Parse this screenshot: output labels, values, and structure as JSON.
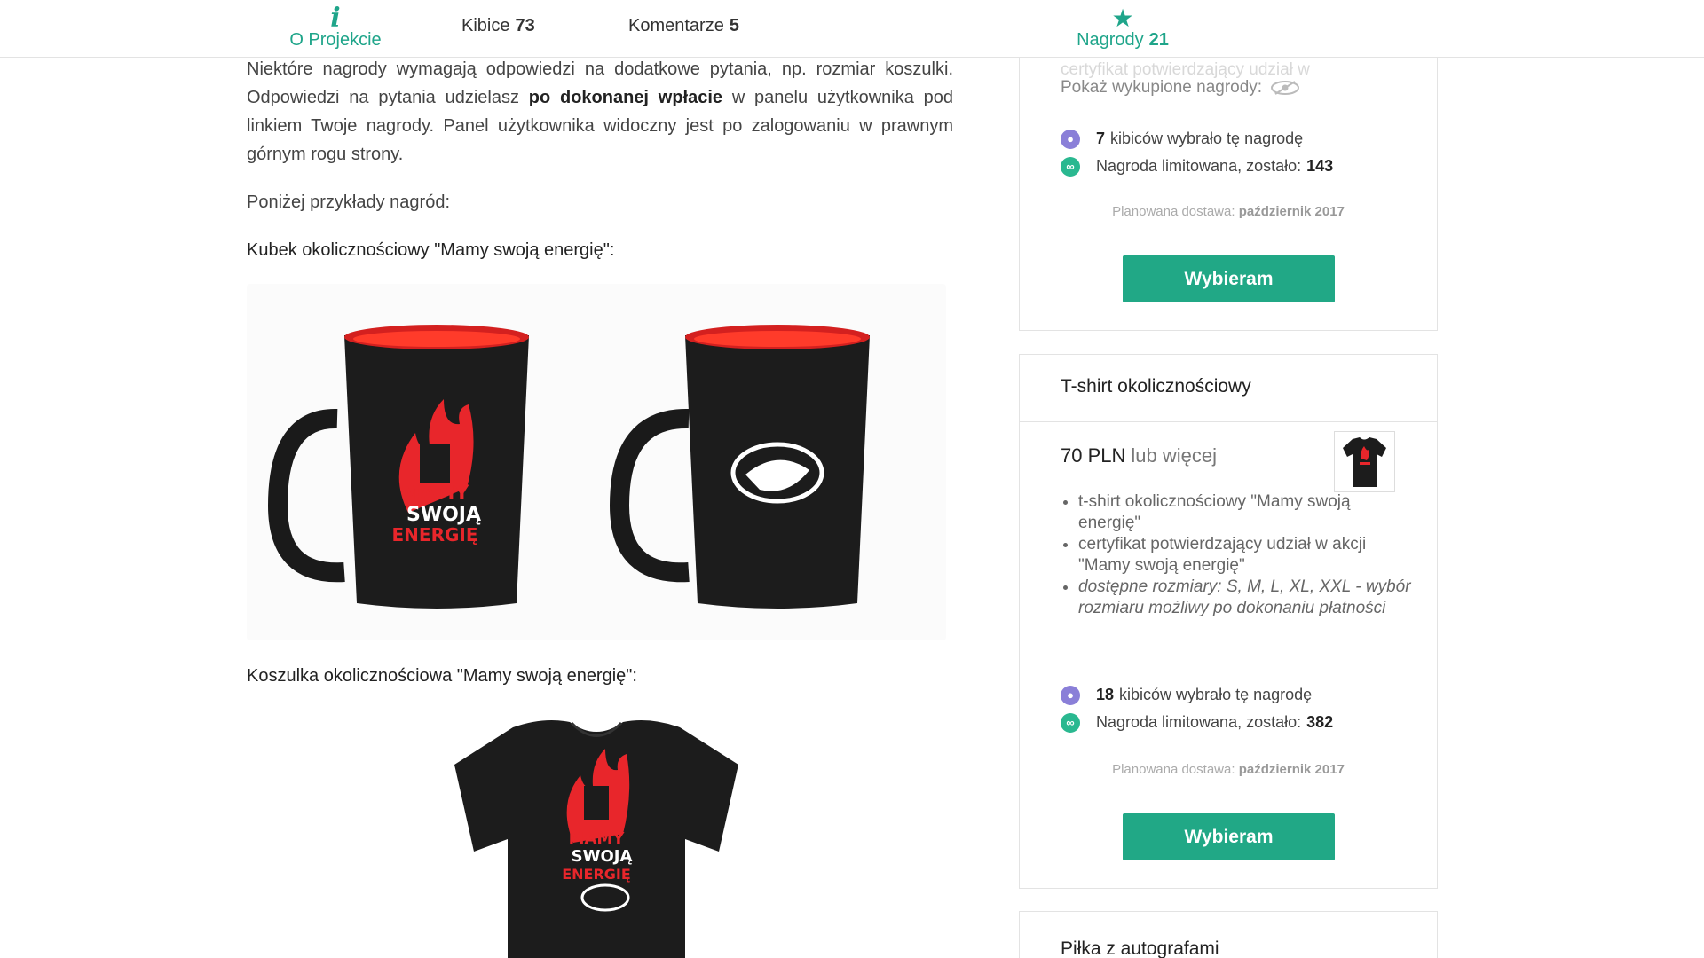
{
  "nav": {
    "about": {
      "label": "O Projekcie"
    },
    "fans": {
      "label": "Kibice",
      "count": "73"
    },
    "comments": {
      "label": "Komentarze",
      "count": "5"
    },
    "rewards": {
      "label": "Nagrody",
      "count": "21"
    }
  },
  "article": {
    "para1_a": "Niektóre nagrody wymagają odpowiedzi na dodatkowe pytania, np. rozmiar koszulki. Odpowiedzi na pytania udzielasz ",
    "para1_strong": "po dokonanej wpłacie",
    "para1_b": " w panelu użytkownika pod linkiem Twoje nagrody. Panel użytkownika widoczny jest po zalogowaniu w prawnym górnym rogu strony.",
    "para2": "Poniżej przykłady nagród:",
    "heading_mug": "Kubek okolicznościowy \"Mamy swoją energię\":",
    "heading_shirt": "Koszulka okolicznościowa \"Mamy swoją energię\":",
    "logo_line1": "MAMY",
    "logo_line2": "SWOJĄ",
    "logo_line3": "ENERGIĘ"
  },
  "reward1": {
    "ghost_item": "certyfikat potwierdzający udział w",
    "show_redeemed": "Pokaż wykupione nagrody:",
    "supporters_count": "7",
    "supporters_text": "kibiców wybrało tę nagrodę",
    "limit_text": "Nagroda limitowana, zostało:",
    "limit_count": "143",
    "delivery_label": "Planowana dostawa:",
    "delivery_date": "październik 2017",
    "button": "Wybieram"
  },
  "reward2": {
    "title": "T-shirt okolicznościowy",
    "price": "70 PLN",
    "price_suffix": "lub więcej",
    "perks": [
      "t-shirt okolicznościowy \"Mamy swoją energię\"",
      "certyfikat potwierdzający udział w akcji \"Mamy swoją energię\"",
      "dostępne rozmiary:  S, M, L, XL, XXL - wybór rozmiaru możliwy po dokonaniu płatności"
    ],
    "supporters_count": "18",
    "supporters_text": "kibiców wybrało tę nagrodę",
    "limit_text": "Nagroda limitowana, zostało:",
    "limit_count": "382",
    "delivery_label": "Planowana dostawa:",
    "delivery_date": "październik 2017",
    "button": "Wybieram"
  },
  "reward3": {
    "title": "Piłka z autografami"
  },
  "colors": {
    "accent": "#21a886",
    "purple_icon": "#8a7fd8",
    "logo_red": "#e8262b"
  },
  "icons": [
    "info-icon",
    "star-icon",
    "eye-icon",
    "user-icon",
    "infinity-icon"
  ]
}
